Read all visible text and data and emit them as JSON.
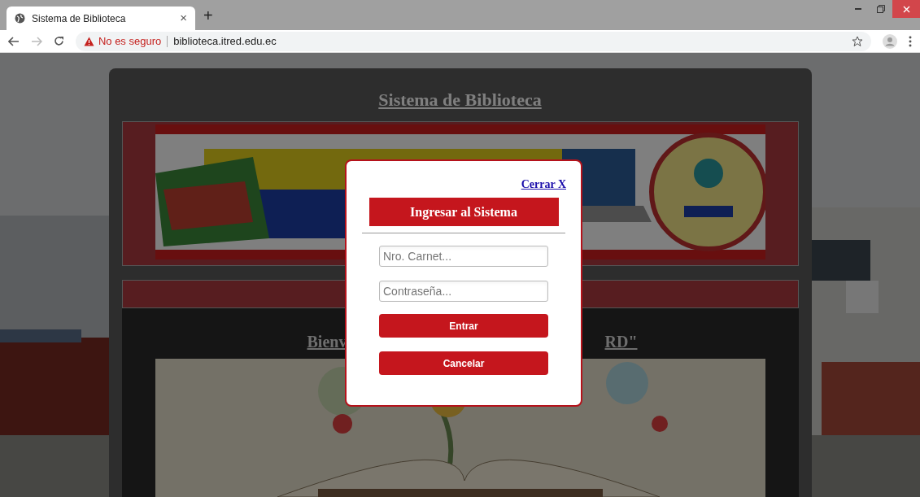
{
  "browser": {
    "tabs": [
      {
        "title": "Sistema de Biblioteca",
        "close": "×",
        "selected": true
      }
    ],
    "new_tab": "+",
    "address": {
      "security": "No es seguro",
      "url": "biblioteca.itred.edu.ec"
    }
  },
  "page": {
    "heading": "Sistema de Biblioteca",
    "welcome_start": "Bienv",
    "welcome_end": "RD\""
  },
  "modal": {
    "close_link": "Cerrar X",
    "title": "Ingresar al Sistema",
    "fields": [
      {
        "placeholder": "Nro. Carnet..."
      },
      {
        "placeholder": "Contraseña..."
      }
    ],
    "buttons": [
      "Entrar",
      "Cancelar"
    ]
  }
}
